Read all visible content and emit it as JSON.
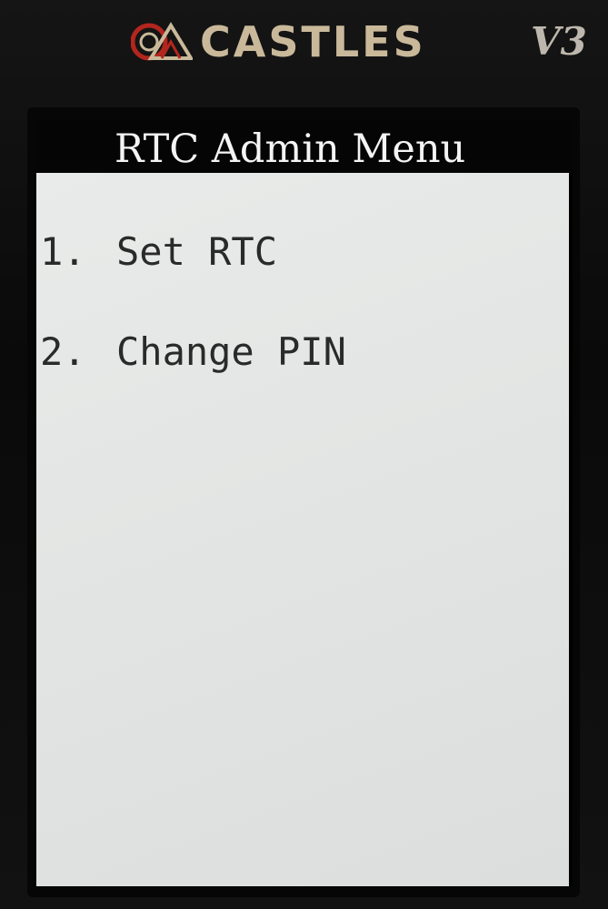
{
  "device": {
    "brand": "CASTLES",
    "model": "V3",
    "logo_icon": "castles-logo-icon"
  },
  "screen": {
    "title": "RTC Admin Menu",
    "menu": [
      {
        "number": "1.",
        "label": "Set RTC"
      },
      {
        "number": "2.",
        "label": "Change PIN"
      }
    ]
  },
  "colors": {
    "brand_text": "#c9b99a",
    "logo_red": "#b3261e",
    "screen_background": "#e5e7e6",
    "title_bar": "#050505",
    "menu_text": "#2a2a2a"
  }
}
